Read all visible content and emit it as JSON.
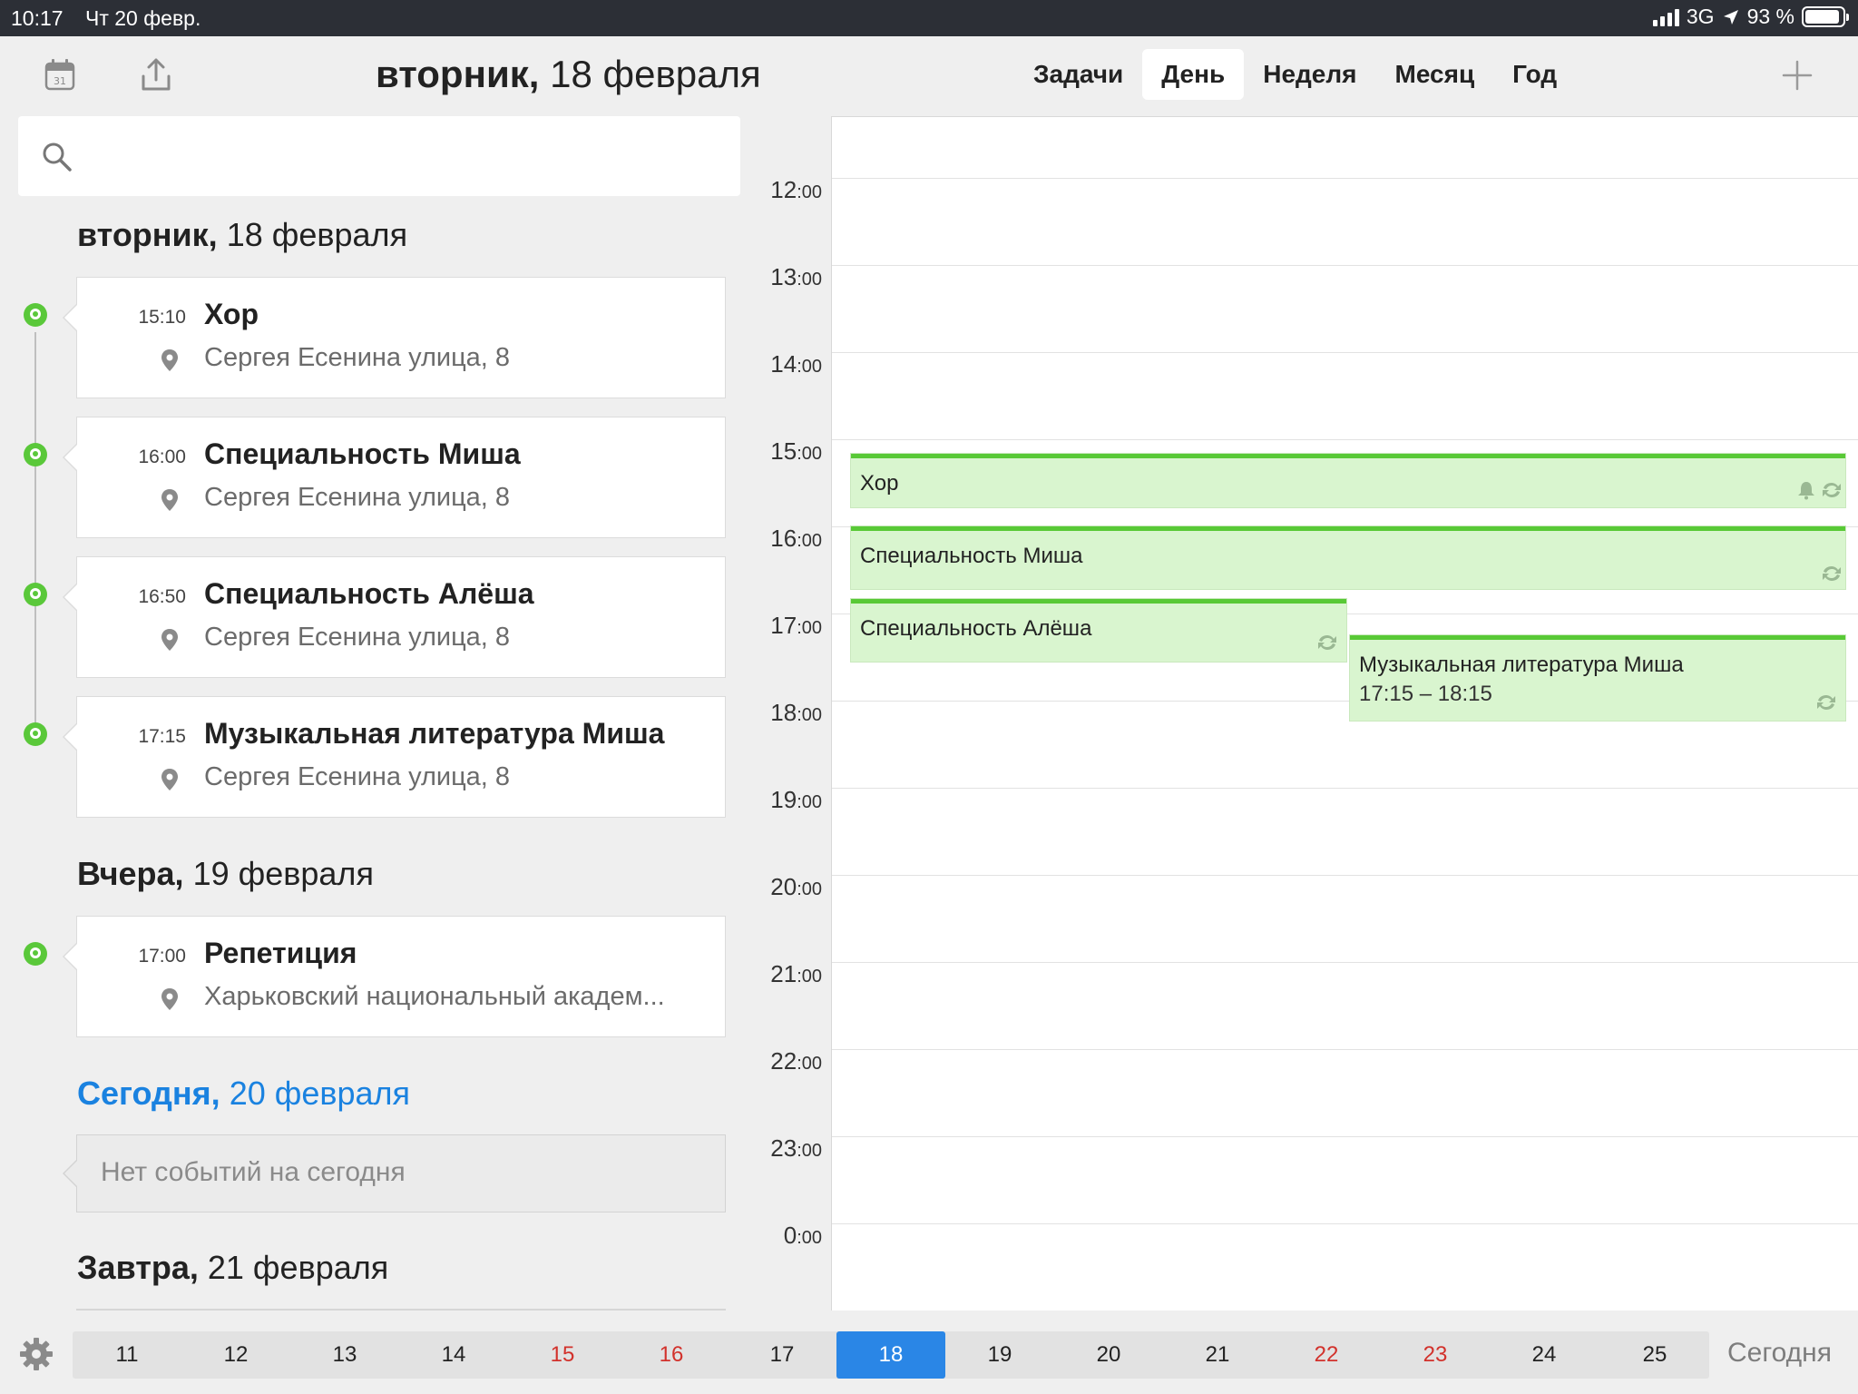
{
  "status_bar": {
    "time": "10:17",
    "date": "Чт 20 февр.",
    "network": "3G",
    "battery": "93 %",
    "battery_level": 0.93
  },
  "header": {
    "title_weekday": "вторник,",
    "title_date": "18 февраля",
    "tabs": [
      {
        "label": "Задачи",
        "active": false
      },
      {
        "label": "День",
        "active": true
      },
      {
        "label": "Неделя",
        "active": false
      },
      {
        "label": "Месяц",
        "active": false
      },
      {
        "label": "Год",
        "active": false
      }
    ]
  },
  "search": {
    "placeholder": ""
  },
  "agenda": {
    "sections": [
      {
        "weekday": "вторник,",
        "date": "18 февраля",
        "events": [
          {
            "time": "15:10",
            "title": "Хор",
            "location": "Сергея Есенина улица, 8"
          },
          {
            "time": "16:00",
            "title": "Специальность Миша",
            "location": "Сергея Есенина улица, 8"
          },
          {
            "time": "16:50",
            "title": "Специальность Алёша",
            "location": "Сергея Есенина улица, 8"
          },
          {
            "time": "17:15",
            "title": "Музыкальная литература Миша",
            "location": "Сергея Есенина улица, 8"
          }
        ]
      },
      {
        "weekday": "Вчера,",
        "date": "19 февраля",
        "events": [
          {
            "time": "17:00",
            "title": "Репетиция",
            "location": "Харьковский национальный академ..."
          }
        ]
      },
      {
        "weekday": "Сегодня,",
        "date": "20 февраля",
        "empty_text": "Нет событий на сегодня"
      },
      {
        "weekday": "Завтра,",
        "date": "21 февраля"
      }
    ]
  },
  "day_view": {
    "hours": [
      {
        "h": "12",
        "m": ":00"
      },
      {
        "h": "13",
        "m": ":00"
      },
      {
        "h": "14",
        "m": ":00"
      },
      {
        "h": "15",
        "m": ":00"
      },
      {
        "h": "16",
        "m": ":00"
      },
      {
        "h": "17",
        "m": ":00"
      },
      {
        "h": "18",
        "m": ":00"
      },
      {
        "h": "19",
        "m": ":00"
      },
      {
        "h": "20",
        "m": ":00"
      },
      {
        "h": "21",
        "m": ":00"
      },
      {
        "h": "22",
        "m": ":00"
      },
      {
        "h": "23",
        "m": ":00"
      },
      {
        "h": "0",
        "m": ":00"
      }
    ],
    "events": [
      {
        "title": "Хор",
        "time": "",
        "icons": [
          "bell-icon",
          "repeat-icon"
        ]
      },
      {
        "title": "Специальность Миша",
        "time": "",
        "icons": [
          "repeat-icon"
        ]
      },
      {
        "title": "Специальность Алёша",
        "time": "",
        "icons": [
          "repeat-icon"
        ]
      },
      {
        "title": "Музыкальная литература Миша",
        "time": "17:15 – 18:15",
        "icons": [
          "repeat-icon"
        ]
      }
    ],
    "event_color": "#d9f5cf",
    "event_accent": "#58c936"
  },
  "date_strip": {
    "days": [
      {
        "label": "11",
        "weekend": false,
        "selected": false
      },
      {
        "label": "12",
        "weekend": false,
        "selected": false
      },
      {
        "label": "13",
        "weekend": false,
        "selected": false
      },
      {
        "label": "14",
        "weekend": false,
        "selected": false
      },
      {
        "label": "15",
        "weekend": true,
        "selected": false
      },
      {
        "label": "16",
        "weekend": true,
        "selected": false
      },
      {
        "label": "17",
        "weekend": false,
        "selected": false
      },
      {
        "label": "18",
        "weekend": false,
        "selected": true
      },
      {
        "label": "19",
        "weekend": false,
        "selected": false
      },
      {
        "label": "20",
        "weekend": false,
        "selected": false
      },
      {
        "label": "21",
        "weekend": false,
        "selected": false
      },
      {
        "label": "22",
        "weekend": true,
        "selected": false
      },
      {
        "label": "23",
        "weekend": true,
        "selected": false
      },
      {
        "label": "24",
        "weekend": false,
        "selected": false
      },
      {
        "label": "25",
        "weekend": false,
        "selected": false
      }
    ],
    "today_label": "Сегодня"
  },
  "colors": {
    "accent_blue": "#2a86e6",
    "pin_green": "#5ac83a",
    "weekend_red": "#d2312b"
  }
}
